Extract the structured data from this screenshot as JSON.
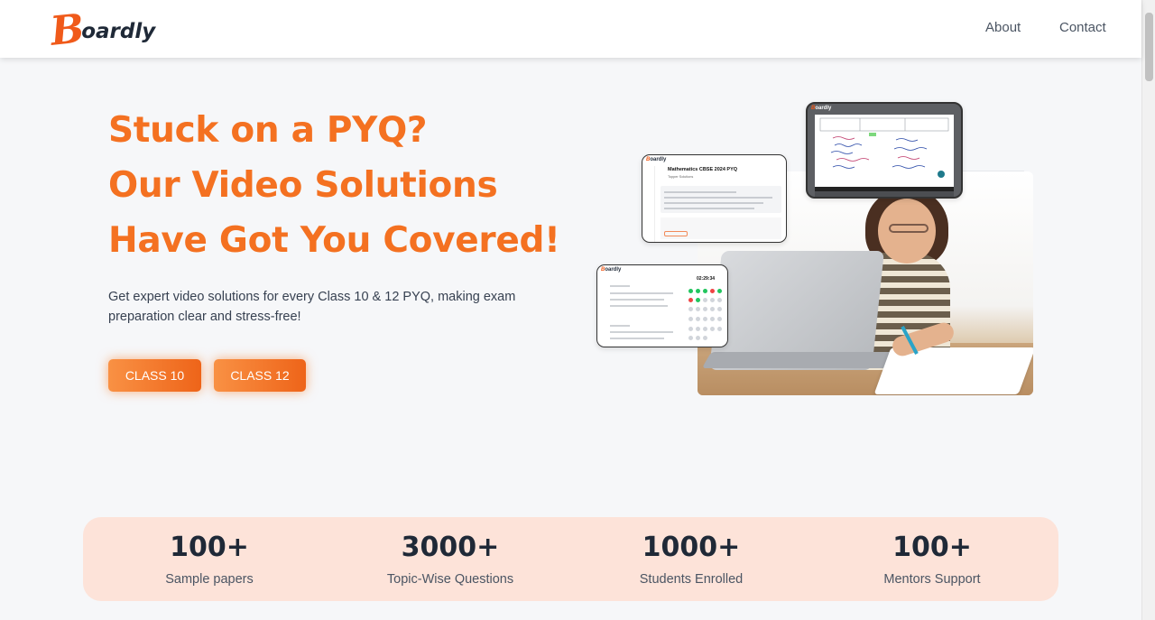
{
  "header": {
    "logo_initial": "B",
    "logo_rest": "oardly",
    "nav": {
      "about": "About",
      "contact": "Contact"
    }
  },
  "hero": {
    "headline_1": "Stuck on a PYQ?",
    "headline_2": "Our Video Solutions",
    "headline_3": "Have Got You Covered!",
    "subtitle": "Get expert video solutions for every Class 10 & 12 PYQ, making exam preparation clear and stress-free!",
    "buttons": {
      "class10": "CLASS 10",
      "class12": "CLASS 12"
    }
  },
  "mockups": {
    "card1_title": "Mathematics CBSE 2024 PYQ",
    "card1_subtitle": "Topper Solutions",
    "card2_timer": "02:29:34"
  },
  "stats": [
    {
      "value": "100+",
      "label": "Sample papers"
    },
    {
      "value": "3000+",
      "label": "Topic-Wise Questions"
    },
    {
      "value": "1000+",
      "label": "Students Enrolled"
    },
    {
      "value": "100+",
      "label": "Mentors Support"
    }
  ],
  "colors": {
    "accent": "#f47121",
    "stats_bg": "#fde3d9",
    "page_bg": "#f6f7f9"
  }
}
